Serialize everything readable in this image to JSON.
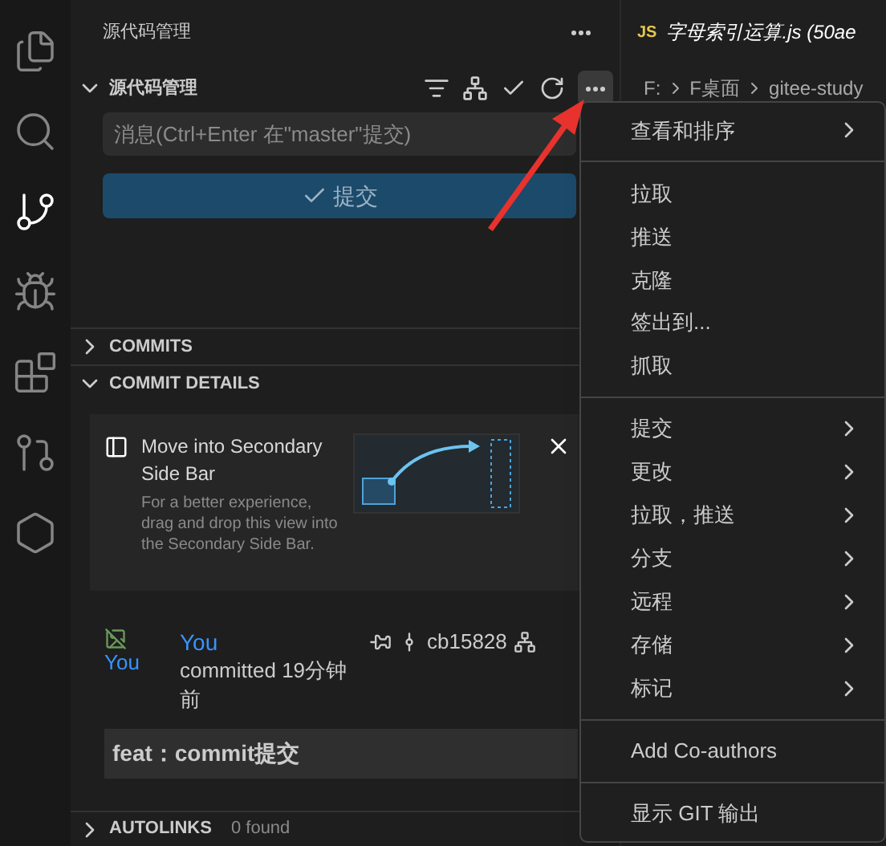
{
  "activity_bar": [
    {
      "selected": false
    },
    {
      "selected": false
    },
    {
      "selected": true
    },
    {
      "selected": false
    },
    {
      "selected": false
    },
    {
      "selected": false
    },
    {
      "selected": false
    }
  ],
  "sidebar": {
    "title": "源代码管理",
    "section": {
      "title": "源代码管理",
      "expanded": true
    },
    "message": {
      "placeholder": "消息(Ctrl+Enter 在\"master\"提交)"
    },
    "commit_button": "提交",
    "panels": [
      {
        "title": "COMMITS",
        "expanded": false
      },
      {
        "title": "COMMIT DETAILS",
        "expanded": true
      }
    ],
    "hint": {
      "title": "Move into Secondary Side Bar",
      "body": "For a better experience, drag and drop this view into the Secondary Side Bar."
    },
    "commit": {
      "avatar_alt": "You",
      "author": "You",
      "time": "committed 19分钟前",
      "hash": "cb15828",
      "message": "feat：commit提交"
    },
    "autolinks": {
      "title": "AUTOLINKS",
      "count": "0 found",
      "expanded": false
    }
  },
  "editor": {
    "tab": {
      "badge": "JS",
      "label": "字母索引运算.js (50ae"
    },
    "breadcrumb": [
      "F:",
      "F桌面",
      "gitee-study"
    ]
  },
  "menu": {
    "groups": [
      [
        {
          "label": "查看和排序",
          "submenu": true
        }
      ],
      [
        {
          "label": "拉取",
          "submenu": false
        },
        {
          "label": "推送",
          "submenu": false
        },
        {
          "label": "克隆",
          "submenu": false
        },
        {
          "label": "签出到...",
          "submenu": false
        },
        {
          "label": "抓取",
          "submenu": false
        }
      ],
      [
        {
          "label": "提交",
          "submenu": true
        },
        {
          "label": "更改",
          "submenu": true
        },
        {
          "label": "拉取，推送",
          "submenu": true
        },
        {
          "label": "分支",
          "submenu": true
        },
        {
          "label": "远程",
          "submenu": true
        },
        {
          "label": "存储",
          "submenu": true
        },
        {
          "label": "标记",
          "submenu": true
        }
      ],
      [
        {
          "label": "Add Co-authors",
          "submenu": false
        }
      ],
      [
        {
          "label": "显示 GIT 输出",
          "submenu": false
        }
      ]
    ]
  }
}
